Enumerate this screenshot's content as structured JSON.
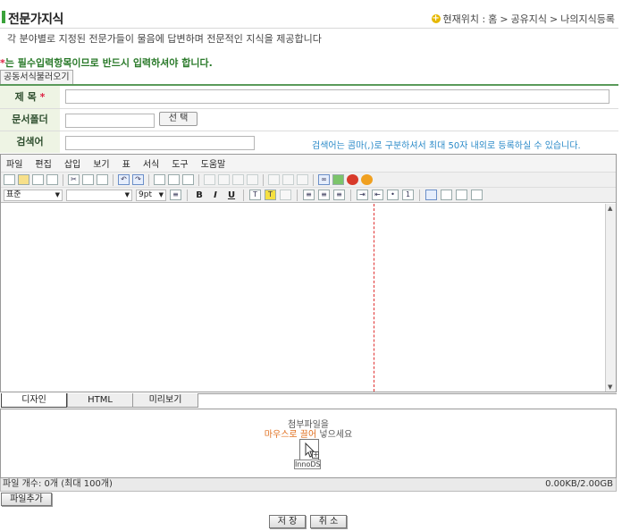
{
  "header": {
    "title": "전문가지식",
    "breadcrumb_prefix": "현재위치 :",
    "breadcrumb": [
      "홈",
      "공유지식",
      "나의지식등록"
    ],
    "breadcrumb_sep": ">",
    "description": "각 분야별로 지정된 전문가들이 물음에 답변하며 전문적인 지식을 제공합니다"
  },
  "form": {
    "required_note": "는 필수입력항목이므로 반드시 입력하셔야 합니다.",
    "required_star": "*",
    "template_tab": "공동서식불러오기",
    "title_label": "제 목",
    "folder_label": "문서폴더",
    "select_button": "선 택",
    "keyword_label": "검색어",
    "keyword_hint": "검색어는 콤마(,)로 구분하셔서 최대 50자 내외로 등록하실 수 있습니다.",
    "title_value": "",
    "folder_value": "",
    "keyword_value": ""
  },
  "editor": {
    "menu": [
      "파일",
      "편집",
      "삽입",
      "보기",
      "표",
      "서식",
      "도구",
      "도움말"
    ],
    "style_select": "표준",
    "font_select": "",
    "size_select": "9pt",
    "modes": [
      "디자인",
      "HTML",
      "미리보기"
    ],
    "active_mode": 0
  },
  "attachment": {
    "line1": "첨부파일을",
    "line2_highlight": "마우스로 끌어",
    "line2_rest": "넣으세요",
    "drop_label": "InnoDS",
    "file_count": "파일 개수: 0개 (최대 100개)",
    "file_size": "0.00KB/2.00GB",
    "add_button": "파일추가"
  },
  "actions": {
    "save": "저 장",
    "cancel": "취 소"
  },
  "colors": {
    "accent_green": "#3aa23a",
    "label_bg": "#eef4e4",
    "hint_blue": "#2a8ac8",
    "drag_orange": "#e07020"
  }
}
